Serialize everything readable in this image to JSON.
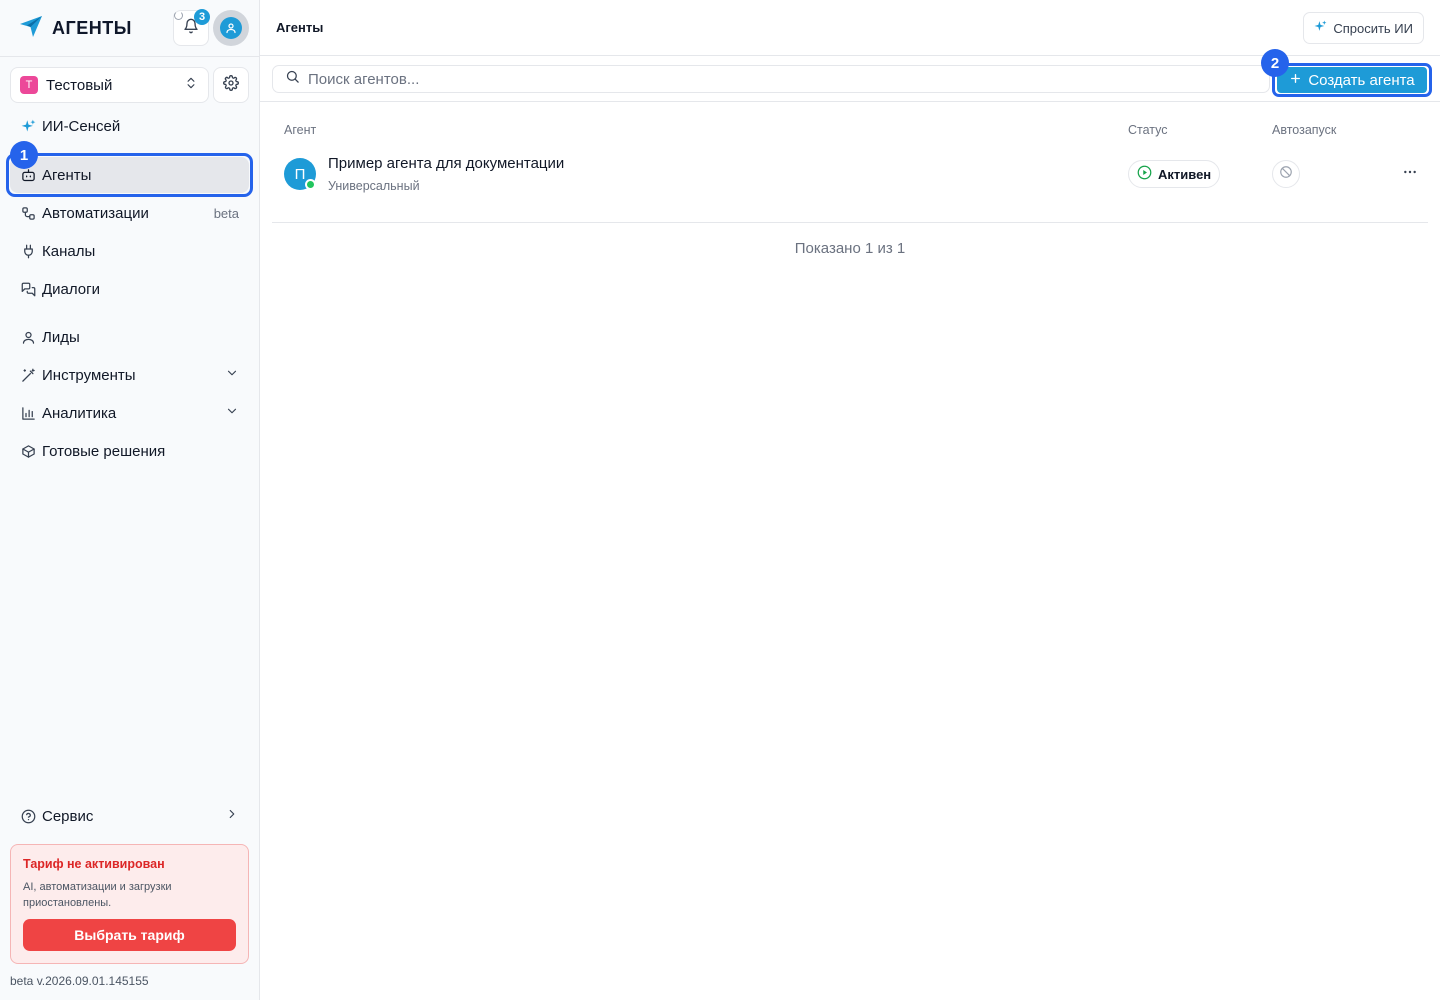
{
  "brand": {
    "name": "АГЕНТЫ",
    "notifications_count": "3"
  },
  "workspace": {
    "initial": "Т",
    "name": "Тестовый"
  },
  "sidebar": {
    "items": [
      {
        "label": "ИИ-Сенсей",
        "icon": "sparkle-icon"
      },
      {
        "label": "Агенты",
        "icon": "bot-icon",
        "active": true
      },
      {
        "label": "Автоматизации",
        "icon": "workflow-icon",
        "tag": "beta"
      },
      {
        "label": "Каналы",
        "icon": "plug-icon"
      },
      {
        "label": "Диалоги",
        "icon": "chat-icon"
      },
      {
        "label": "Лиды",
        "icon": "user-icon"
      },
      {
        "label": "Инструменты",
        "icon": "wand-icon",
        "expandable": true
      },
      {
        "label": "Аналитика",
        "icon": "bar-chart-icon",
        "expandable": true
      },
      {
        "label": "Готовые решения",
        "icon": "box-icon"
      }
    ],
    "service": {
      "label": "Сервис",
      "icon": "help-circle-icon"
    }
  },
  "plan": {
    "title": "Тариф не активирован",
    "description": "AI, автоматизации и загрузки приостановлены.",
    "button": "Выбрать тариф"
  },
  "version": "beta v.2026.09.01.145155",
  "header": {
    "title": "Агенты",
    "ask_ai": "Спросить ИИ"
  },
  "toolbar": {
    "search_placeholder": "Поиск агентов...",
    "create_label": "Создать агента"
  },
  "annotations": {
    "step1": "1",
    "step2": "2"
  },
  "table": {
    "columns": {
      "agent": "Агент",
      "status": "Статус",
      "autostart": "Автозапуск"
    },
    "rows": [
      {
        "initial": "П",
        "name": "Пример агента для документации",
        "type": "Универсальный",
        "status": "Активен",
        "online": true,
        "autostart": false
      }
    ],
    "footer": "Показано 1 из 1"
  },
  "colors": {
    "accent": "#1e9bd7",
    "focus": "#2563eb",
    "danger": "#ef4444",
    "online": "#22c55e",
    "workspace_badge": "#ec4899"
  }
}
